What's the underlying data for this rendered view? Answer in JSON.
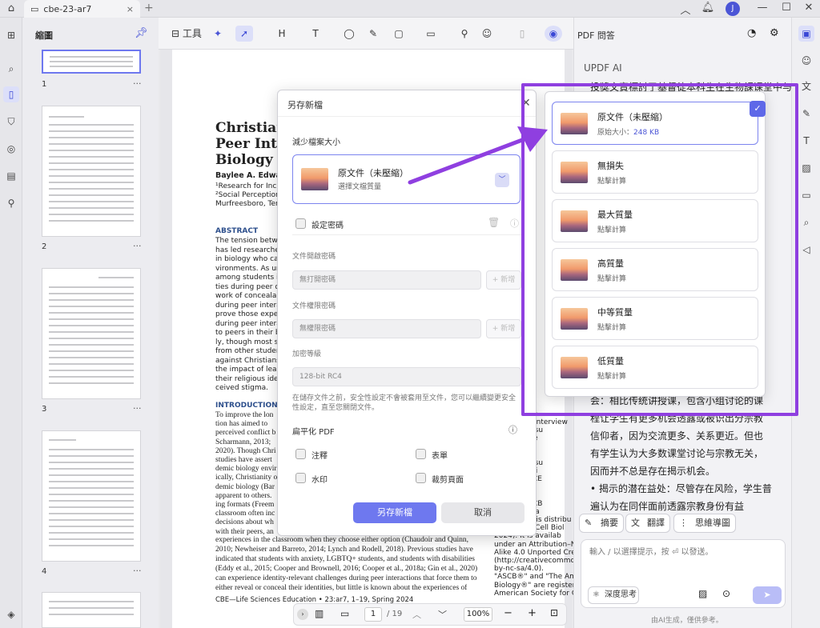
{
  "titlebar": {
    "tab_title": "cbe-23-ar7",
    "new_tab": "+",
    "avatar_initial": "J"
  },
  "thumbs": {
    "title": "縮圖",
    "pages": [
      "1",
      "2",
      "3",
      "4"
    ]
  },
  "toolbar": {
    "tools_label": "工具"
  },
  "document": {
    "title_lines": [
      "Christian",
      "Peer Inter",
      "Biology C"
    ],
    "authors": "Baylee A. Edwards,",
    "affil_lines": [
      "¹Research for Inclusive",
      "²Social Perceptions of",
      "Murfreesboro, Tennes"
    ],
    "abstract_head": "ABSTRACT",
    "abstract_lines": [
      "The tension between",
      "has led researchers",
      "in biology who can",
      "vironments. As unde",
      "among students in",
      "ties during peer disc",
      "work of concealable",
      "during peer interact",
      "prove those experie",
      "during peer interact",
      "to peers in their bio",
      "ly, though most stud",
      "from other students",
      "against Christians in",
      "the impact of learnin",
      "their religious identi",
      "ceived stigma."
    ],
    "intro_head": "INTRODUCTION",
    "intro_lines": [
      "To improve the lon",
      "tion has aimed to",
      "perceived conflict b",
      "Scharmann, 2013;",
      "2020). Though Chri",
      "studies have assert",
      "demic biology envir",
      "ically, Christianity o",
      "demic biology (Bar",
      "apparent to others.",
      "ing formats (Freem",
      "classroom often inc",
      "decisions about wh",
      "with their peers, an"
    ],
    "full_lines": [
      "experiences in the classroom when they choose either option (Chaudoir and Quinn,",
      "2010; Newheiser and Barreto, 2014; Lynch and Rodell, 2018). Previous studies have",
      "indicated that students with anxiety, LGBTQ+ students, and students with disabilities",
      "(Eddy et al., 2015; Cooper and Brownell, 2016; Cooper et al., 2018a; Gin et al., 2020)",
      "can experience identity-relevant challenges during peer interactions that force them to",
      "either reveal or conceal their identities, but little is known about the experiences of"
    ],
    "side_lines": [
      "ce Foundati",
      "",
      "conceived a",
      "conducted interview",
      "erpreted resu",
      "dited and re",
      "review dra",
      "igned resea",
      "erpreted resu",
      "ted and revi",
      "ards et al. CE",
      "ondence to:",
      "",
      "ards et al. CB",
      "The America",
      "This article is distribu",
      "Society for Cell Biol",
      "2024). It is availab",
      "under an Attribution–Noncom",
      "Alike 4.0 Unported Creative C",
      "(http://creativecommons.org/",
      "by-nc-sa/4.0).",
      "\"ASCB®\" and \"The American S",
      "Biology®\" are registered trade",
      "American Society for Cell Biolo"
    ],
    "footer": "CBE—Life Sciences Education  •  23:ar7, 1–19, Spring 2024"
  },
  "bottom_nav": {
    "page": "1",
    "total": "/ 19",
    "zoom": "100%"
  },
  "dialog": {
    "title": "另存新檔",
    "section_reduce": "減少檔案大小",
    "selected_name": "原文件（未壓縮）",
    "selected_sub": "選擇文檔質量",
    "password_label": "設定密碼",
    "open_pw_label": "文件開啟密碼",
    "open_pw_value": "無打開密碼",
    "new_btn": "+ 新增",
    "perm_pw_label": "文件權限密碼",
    "perm_pw_value": "無權限密碼",
    "enc_label": "加密等級",
    "enc_value": "128-bit RC4",
    "note": [
      "在儲存文件之前，安全性設定不會被套用至文件，您可以繼續變更安全",
      "性設定，直至您關閉文件。"
    ],
    "flatten_label": "扁平化 PDF",
    "flatten_options": [
      "注釋",
      "表單",
      "水印",
      "裁剪頁面"
    ],
    "save_label": "另存新檔",
    "cancel_label": "取消"
  },
  "quality_options": [
    {
      "name": "原文件（未壓縮）",
      "sub_prefix": "原始大小：",
      "sub_value": "248 KB",
      "selected": true
    },
    {
      "name": "無損失",
      "sub_prefix": "點擊計算",
      "sub_value": "",
      "selected": false
    },
    {
      "name": "最大質量",
      "sub_prefix": "點擊計算",
      "sub_value": "",
      "selected": false
    },
    {
      "name": "高質量",
      "sub_prefix": "點擊計算",
      "sub_value": "",
      "selected": false
    },
    {
      "name": "中等質量",
      "sub_prefix": "點擊計算",
      "sub_value": "",
      "selected": false
    },
    {
      "name": "低質量",
      "sub_prefix": "點擊計算",
      "sub_value": "",
      "selected": false
    }
  ],
  "right_panel": {
    "title": "PDF 問答",
    "subtitle": "UPDF AI",
    "ai_lines_top": [
      "投獎文實標討了基督徒本科生在生物課课堂中与"
    ],
    "ai_lines_bottom": [
      "会：相比传统讲授课，包含小组讨论的课",
      "程让学生有更多机会透露或被识出分宗教",
      "信仰者，因为交流更多、关系更近。但也",
      "有学生认为大多数课堂讨论与宗教无关，",
      "因而并不总是存在揭示机会。",
      "• 揭示的潜在益处：尽管存在风险，学生普",
      "遍认为在同伴面前透露宗教身份有益"
    ],
    "chips": [
      "摘要",
      "翻譯",
      "思維導圖"
    ],
    "input_placeholder": "輸入 / 以選擇提示，按 ⏎ 以發送。",
    "deep_label": "深度思考",
    "footer": "由AI生成，僅供參考。"
  },
  "colors": {
    "accent": "#6e78ef",
    "annotation": "#8f3fe0"
  }
}
